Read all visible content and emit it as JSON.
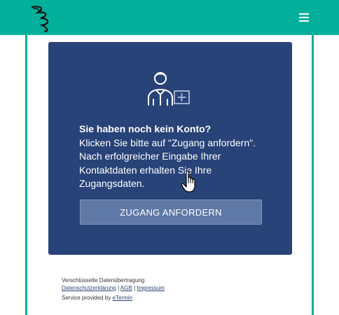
{
  "header": {
    "logo_icon": "swirl-logo-icon",
    "menu_icon": "hamburger-menu-icon",
    "bar_color": "#00b09b"
  },
  "card": {
    "icon": "user-add-icon",
    "heading": "Sie haben noch kein Konto?",
    "body": "Klicken Sie bitte auf \"Zugang anfordern\". Nach erfolgreicher Eingabe Ihrer Kontaktdaten erhalten Sie Ihre Zugangsdaten.",
    "button_label": "ZUGANG ANFORDERN",
    "background": "#284378"
  },
  "footer": {
    "encryption_note": "Verschlüsselte Datenübertragung",
    "privacy_link": "Datenschutzerklärung",
    "sep1": "|",
    "agb_link": "AGB",
    "sep2": "|",
    "imprint_link": "Impressum",
    "service_prefix": "Service provided by",
    "service_link": "eTermin"
  }
}
